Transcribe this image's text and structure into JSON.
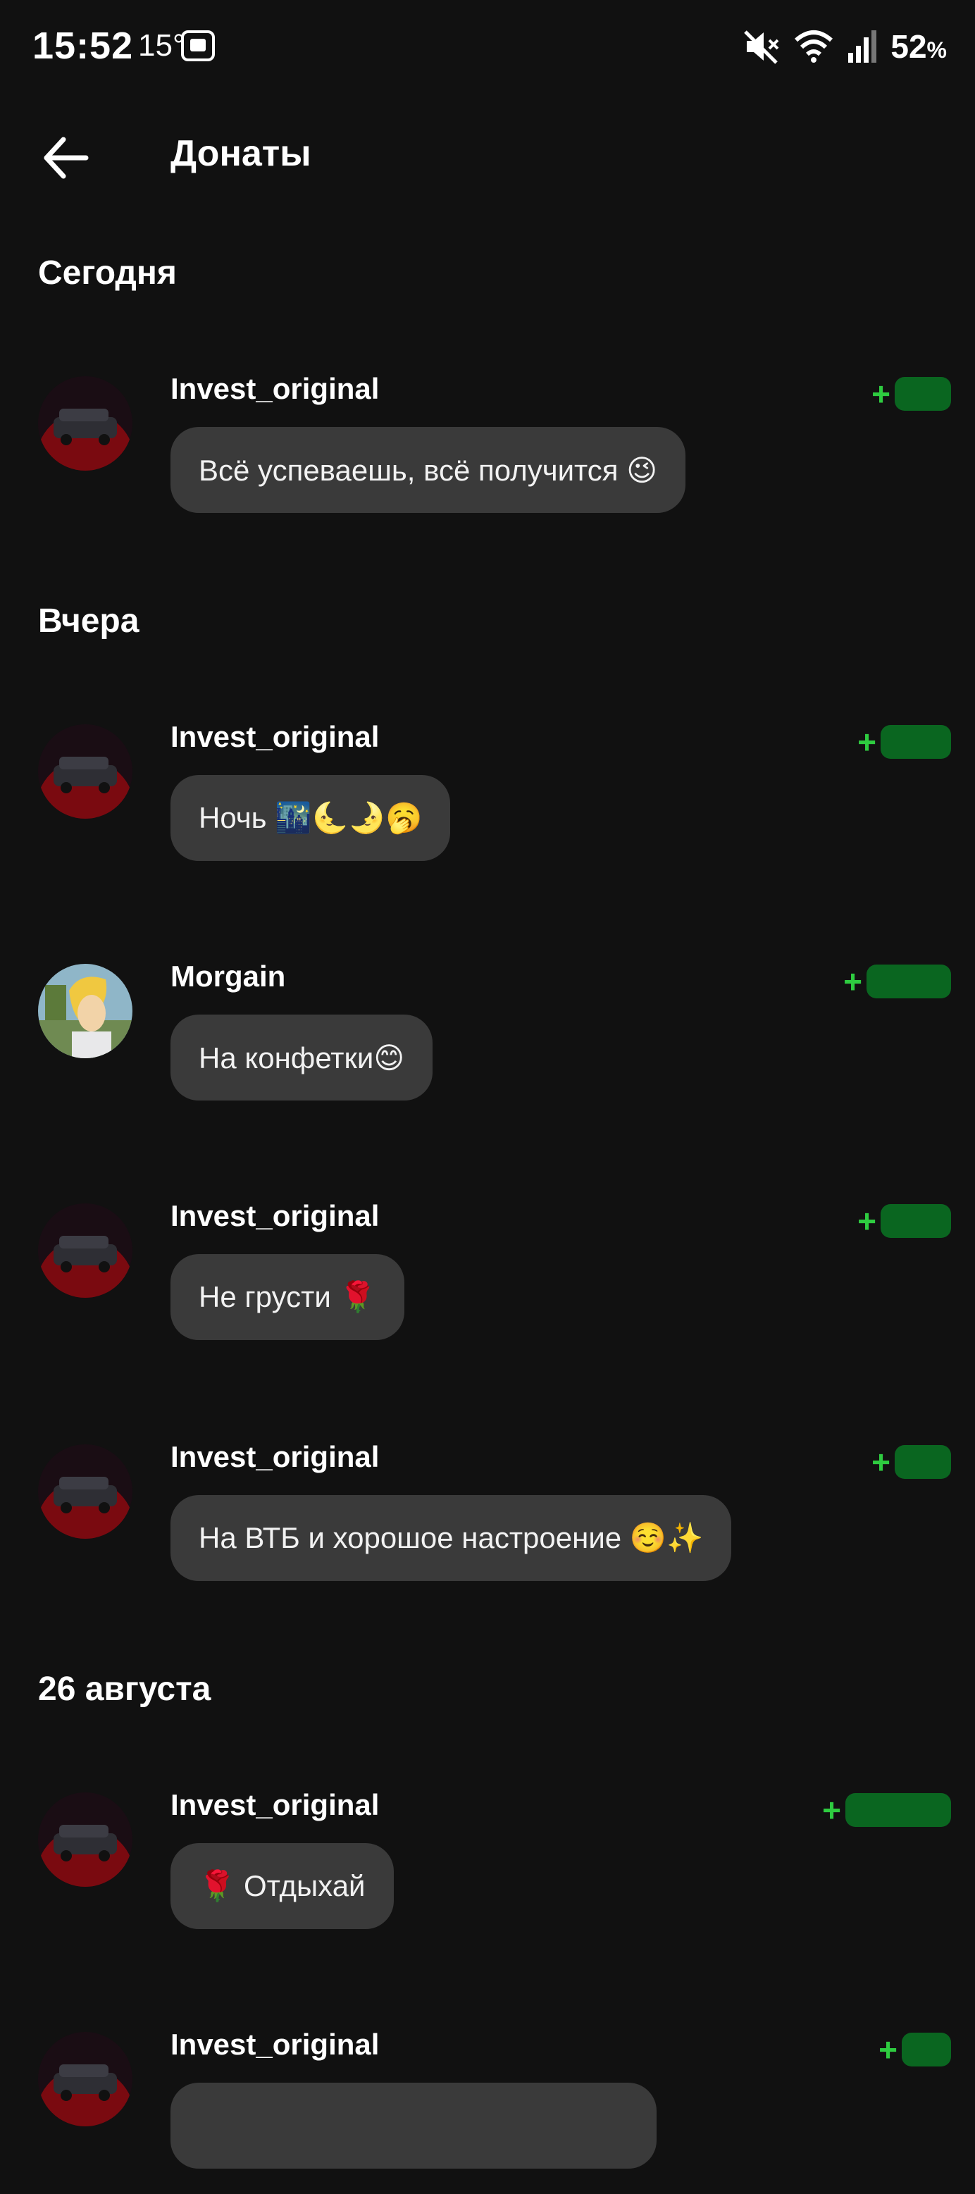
{
  "status": {
    "time": "15:52",
    "temp": "15°",
    "battery": "52",
    "battery_unit": "%"
  },
  "header": {
    "title": "Донаты"
  },
  "sections": {
    "today": "Сегодня",
    "yesterday": "Вчера",
    "aug26": "26 августа"
  },
  "plus": "+",
  "donations": [
    {
      "user": "Invest_original",
      "message": "Всё успеваешь, всё получится 😉"
    },
    {
      "user": "Invest_original",
      "message": "Ночь 🌃🌜🌛🥱"
    },
    {
      "user": "Morgain",
      "message": "На конфетки😊"
    },
    {
      "user": "Invest_original",
      "message": "Не грусти 🌹"
    },
    {
      "user": "Invest_original",
      "message": "На ВТБ и хорошое настроение ☺️✨"
    },
    {
      "user": "Invest_original",
      "message": "🌹 Отдыхай"
    },
    {
      "user": "Invest_original",
      "message": ""
    }
  ],
  "colors": {
    "background": "#111111",
    "bubble": "#3a3a3a",
    "amount": "#2ecc40"
  }
}
